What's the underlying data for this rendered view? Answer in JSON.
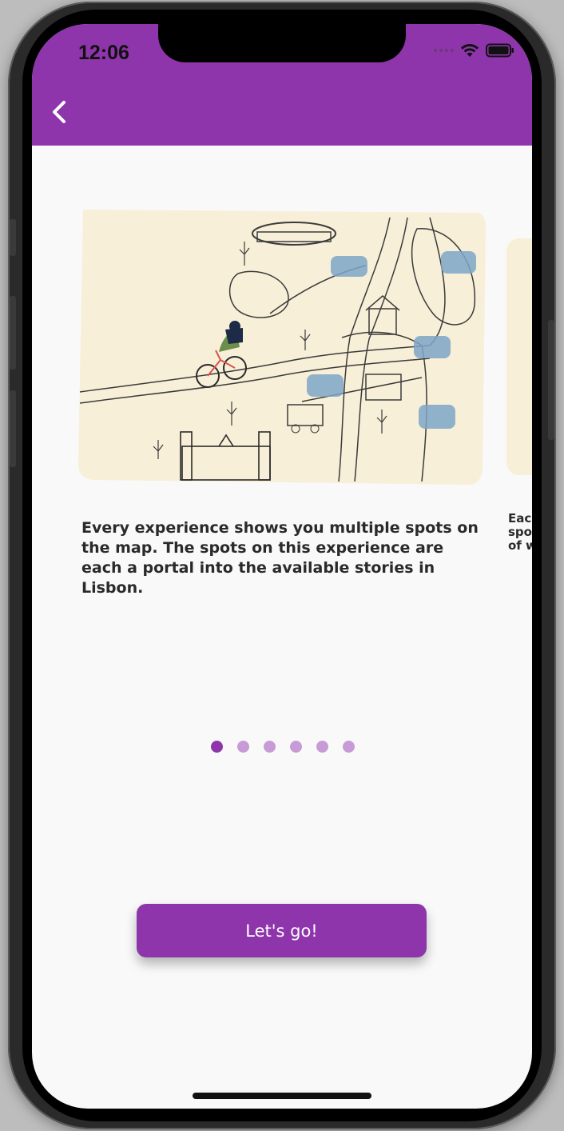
{
  "status_bar": {
    "time": "12:06"
  },
  "slides": {
    "current": {
      "text": "Every experience shows you multiple spots on the map. The spots on this experience are each a portal into the available stories in Lisbon.",
      "image_icon": "illustrated-map-image"
    },
    "next_peek_text": "Eac\nspo\nof w"
  },
  "pagination": {
    "count": 6,
    "active_index": 0
  },
  "cta": {
    "label": "Let's go!"
  },
  "colors": {
    "primary": "#8e35ab",
    "dot_inactive": "#c79bd6",
    "background": "#f9f9f9",
    "map_paper": "#f8efd8",
    "water_spot": "#7ea6c8"
  }
}
